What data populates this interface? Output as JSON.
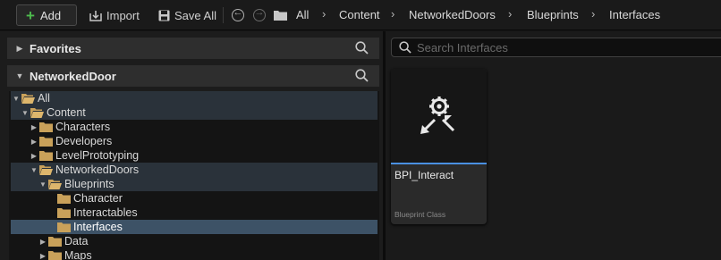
{
  "toolbar": {
    "add_label": "Add",
    "import_label": "Import",
    "save_all_label": "Save All"
  },
  "breadcrumbs": [
    "All",
    "Content",
    "NetworkedDoors",
    "Blueprints",
    "Interfaces"
  ],
  "left_panel": {
    "favorites_label": "Favorites",
    "project_label": "NetworkedDoor",
    "tree": [
      {
        "label": "All",
        "depth": 0,
        "state": "open"
      },
      {
        "label": "Content",
        "depth": 1,
        "state": "open"
      },
      {
        "label": "Characters",
        "depth": 2,
        "state": "closed"
      },
      {
        "label": "Developers",
        "depth": 2,
        "state": "closed"
      },
      {
        "label": "LevelPrototyping",
        "depth": 2,
        "state": "closed"
      },
      {
        "label": "NetworkedDoors",
        "depth": 2,
        "state": "open"
      },
      {
        "label": "Blueprints",
        "depth": 3,
        "state": "open"
      },
      {
        "label": "Character",
        "depth": 4,
        "state": "leaf"
      },
      {
        "label": "Interactables",
        "depth": 4,
        "state": "leaf"
      },
      {
        "label": "Interfaces",
        "depth": 4,
        "state": "leaf"
      },
      {
        "label": "Data",
        "depth": 3,
        "state": "closed"
      },
      {
        "label": "Maps",
        "depth": 3,
        "state": "closed"
      }
    ]
  },
  "right_panel": {
    "search_placeholder": "Search Interfaces",
    "asset": {
      "name": "BPI_Interact",
      "type": "Blueprint Class",
      "icon": "interface-gear-icon"
    }
  },
  "colors": {
    "selection": "#3d5266",
    "highlight": "#2a323a",
    "folder": "#c9a15a",
    "asset_accent": "#4a90e2",
    "add_plus": "#4dbb4d"
  }
}
